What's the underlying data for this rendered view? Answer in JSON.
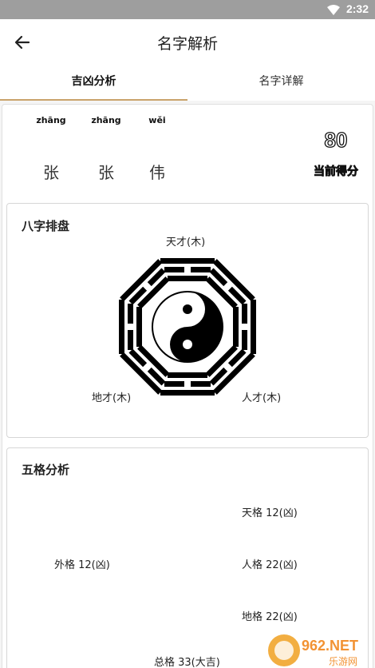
{
  "status": {
    "time": "2:32",
    "wifi_icon": "wifi-icon"
  },
  "header": {
    "title": "名字解析",
    "back_icon": "arrow-left-icon"
  },
  "tabs": [
    {
      "label": "吉凶分析",
      "active": true
    },
    {
      "label": "名字详解",
      "active": false
    }
  ],
  "name": {
    "chars": [
      {
        "pinyin": "zhāng",
        "hanzi": "张"
      },
      {
        "pinyin": "zhāng",
        "hanzi": "张"
      },
      {
        "pinyin": "wěi",
        "hanzi": "伟"
      }
    ],
    "score": "80",
    "score_label": "当前得分"
  },
  "bazi": {
    "title": "八字排盘",
    "tian": "天才(木)",
    "di": "地才(木)",
    "ren": "人才(木)"
  },
  "wuge": {
    "title": "五格分析",
    "tian": "天格 12(凶)",
    "wai": "外格 12(凶)",
    "ren": "人格 22(凶)",
    "di": "地格 22(凶)",
    "zong": "总格 33(大吉)"
  },
  "watermark": {
    "text_top": "962.NET",
    "text_bottom": "乐游网"
  },
  "colors": {
    "accent": "#c9a36b",
    "status_bar": "#9e9e9e"
  }
}
